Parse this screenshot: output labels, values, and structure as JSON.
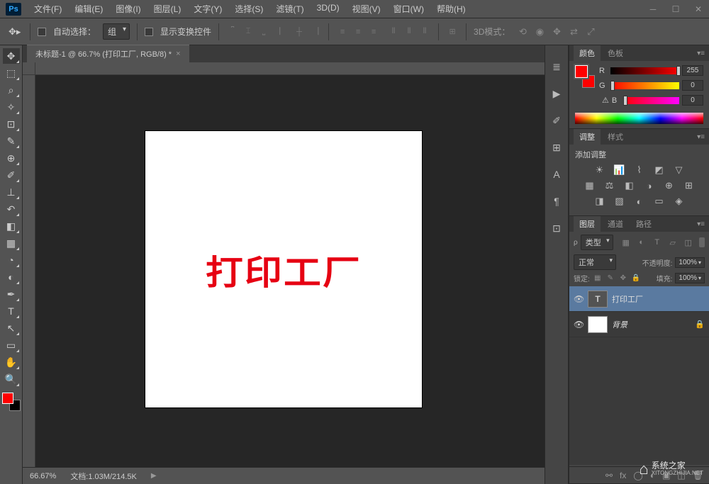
{
  "app": {
    "logo": "Ps"
  },
  "menu": [
    {
      "label": "文件(F)"
    },
    {
      "label": "编辑(E)"
    },
    {
      "label": "图像(I)"
    },
    {
      "label": "图层(L)"
    },
    {
      "label": "文字(Y)"
    },
    {
      "label": "选择(S)"
    },
    {
      "label": "滤镜(T)"
    },
    {
      "label": "3D(D)"
    },
    {
      "label": "视图(V)"
    },
    {
      "label": "窗口(W)"
    },
    {
      "label": "帮助(H)"
    }
  ],
  "options": {
    "auto_select_label": "自动选择：",
    "auto_select_value": "组",
    "show_transform_label": "显示变换控件",
    "mode3d_label": "3D模式："
  },
  "doc": {
    "tab_title": "未标题-1 @ 66.7% (打印工厂, RGB/8) *",
    "canvas_text": "打印工厂"
  },
  "status": {
    "zoom": "66.67%",
    "doc_info": "文档:1.03M/214.5K"
  },
  "color_panel": {
    "tabs": [
      "颜色",
      "色板"
    ],
    "channels": [
      {
        "label": "R",
        "value": "255",
        "thumb_pos": "96%"
      },
      {
        "label": "G",
        "value": "0",
        "thumb_pos": "0%"
      },
      {
        "label": "B",
        "value": "0",
        "thumb_pos": "0%"
      }
    ]
  },
  "adjustments_panel": {
    "tabs": [
      "调整",
      "样式"
    ],
    "title": "添加调整"
  },
  "layers_panel": {
    "tabs": [
      "图层",
      "通道",
      "路径"
    ],
    "filter_label": "类型",
    "blend_mode": "正常",
    "opacity_label": "不透明度:",
    "opacity_value": "100%",
    "lock_label": "锁定:",
    "fill_label": "填充:",
    "fill_value": "100%",
    "layers": [
      {
        "name": "打印工厂",
        "type": "text",
        "selected": true,
        "locked": false
      },
      {
        "name": "背景",
        "type": "raster",
        "selected": false,
        "locked": true,
        "italic": true
      }
    ]
  },
  "watermark": {
    "title": "系统之家",
    "url": "XITONGZHIJIA.NET"
  }
}
